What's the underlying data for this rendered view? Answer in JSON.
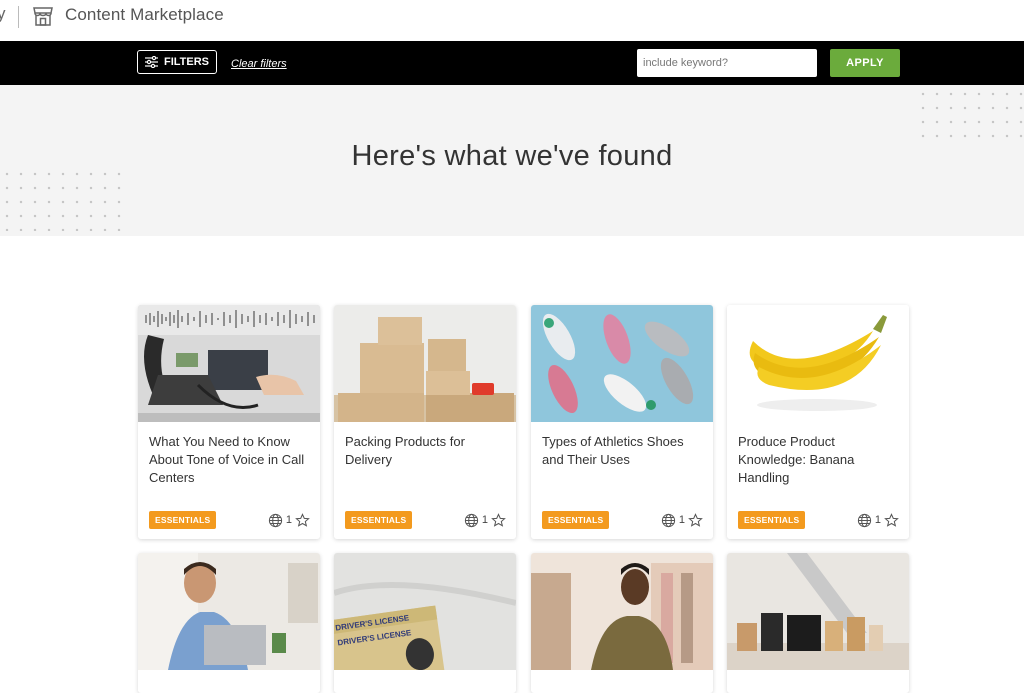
{
  "header": {
    "logo_fragment": "y",
    "store_icon": "store-icon",
    "title": "Content Marketplace"
  },
  "filterbar": {
    "filters_label": "FILTERS",
    "filters_icon": "sliders-icon",
    "clear_label": "Clear filters",
    "keyword_placeholder": "include keyword?",
    "apply_label": "APPLY"
  },
  "hero": {
    "title": "Here's what we've found"
  },
  "colors": {
    "accent_green": "#6bab3c",
    "badge_orange": "#f39a1e",
    "bar_black": "#000000"
  },
  "cards": [
    {
      "title": "What You Need to Know About Tone of Voice in Call Centers",
      "badge": "ESSENTIALS",
      "languages": "1",
      "image": "call-center-phone-headset"
    },
    {
      "title": "Packing Products for Delivery",
      "badge": "ESSENTIALS",
      "languages": "1",
      "image": "stacked-cardboard-boxes"
    },
    {
      "title": "Types of Athletics Shoes and Their Uses",
      "badge": "ESSENTIALS",
      "languages": "1",
      "image": "athletic-sneakers"
    },
    {
      "title": "Produce Product Knowledge: Banana Handling",
      "badge": "ESSENTIALS",
      "languages": "1",
      "image": "banana-bunch"
    }
  ],
  "lower_cards": [
    {
      "image": "man-with-headset-laptop"
    },
    {
      "image": "drivers-license-cards",
      "license_text_1": "DRIVER'S LICENSE",
      "license_text_2": "DRIVER'S LICENSE"
    },
    {
      "image": "woman-clothing-store"
    },
    {
      "image": "mall-shopping-bags"
    }
  ]
}
